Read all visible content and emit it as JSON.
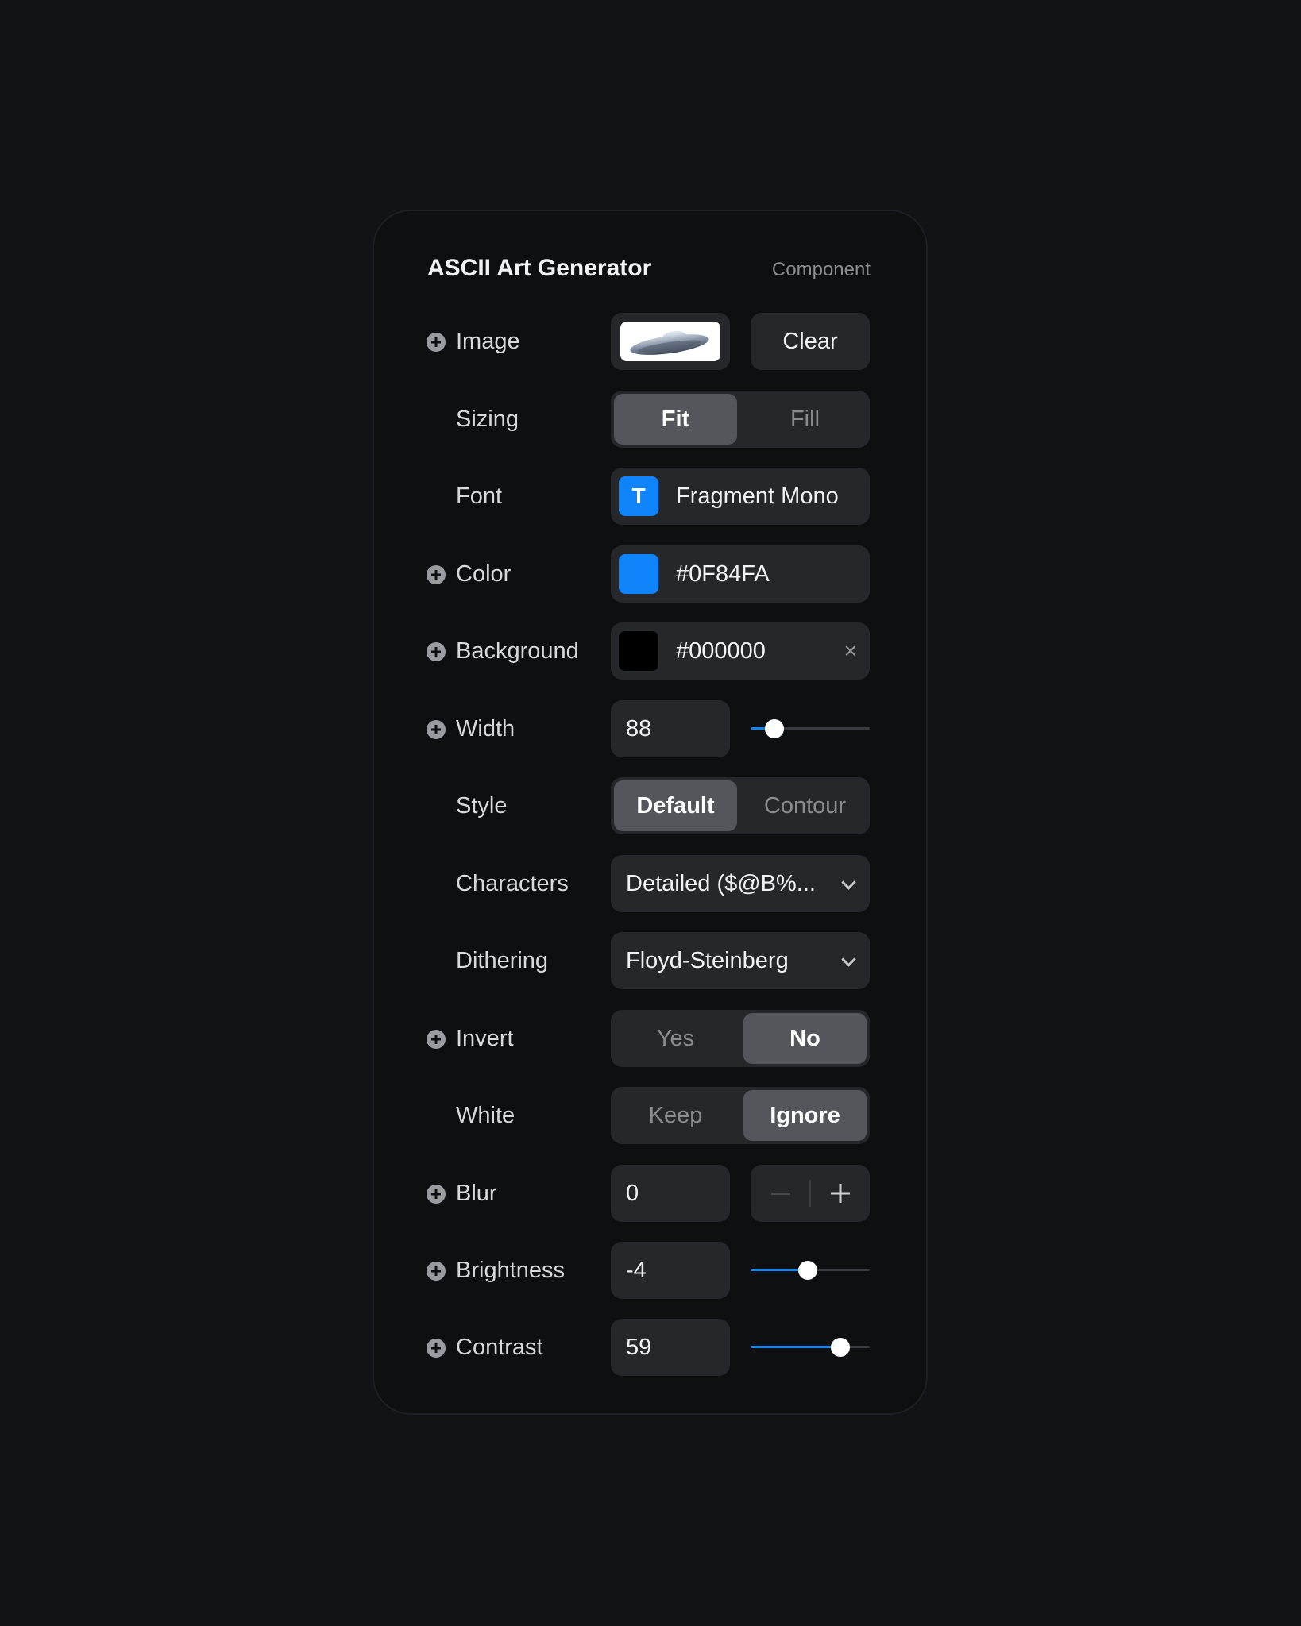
{
  "header": {
    "title": "ASCII Art Generator",
    "subtitle": "Component"
  },
  "colors": {
    "accent": "#0F84FA",
    "panel_background": "#0e0f11",
    "page_background": "#121316"
  },
  "rows": {
    "image": {
      "label": "Image",
      "clear_label": "Clear",
      "thumbnail_icon": "ufo-image-icon"
    },
    "sizing": {
      "label": "Sizing",
      "options": [
        "Fit",
        "Fill"
      ],
      "selected": "Fit"
    },
    "font": {
      "label": "Font",
      "icon_letter": "T",
      "value": "Fragment Mono"
    },
    "color": {
      "label": "Color",
      "value": "#0F84FA",
      "swatch": "#0F84FA"
    },
    "background": {
      "label": "Background",
      "value": "#000000",
      "swatch": "#000000",
      "clear_glyph": "×"
    },
    "width": {
      "label": "Width",
      "value": "88",
      "slider_fraction": 0.2
    },
    "style": {
      "label": "Style",
      "options": [
        "Default",
        "Contour"
      ],
      "selected": "Default"
    },
    "characters": {
      "label": "Characters",
      "value": "Detailed ($@B%..."
    },
    "dithering": {
      "label": "Dithering",
      "value": "Floyd-Steinberg"
    },
    "invert": {
      "label": "Invert",
      "options": [
        "Yes",
        "No"
      ],
      "selected": "No"
    },
    "white": {
      "label": "White",
      "options": [
        "Keep",
        "Ignore"
      ],
      "selected": "Ignore"
    },
    "blur": {
      "label": "Blur",
      "value": "0"
    },
    "brightness": {
      "label": "Brightness",
      "value": "-4",
      "slider_fraction": 0.48
    },
    "contrast": {
      "label": "Contrast",
      "value": "59",
      "slider_fraction": 0.755
    }
  }
}
